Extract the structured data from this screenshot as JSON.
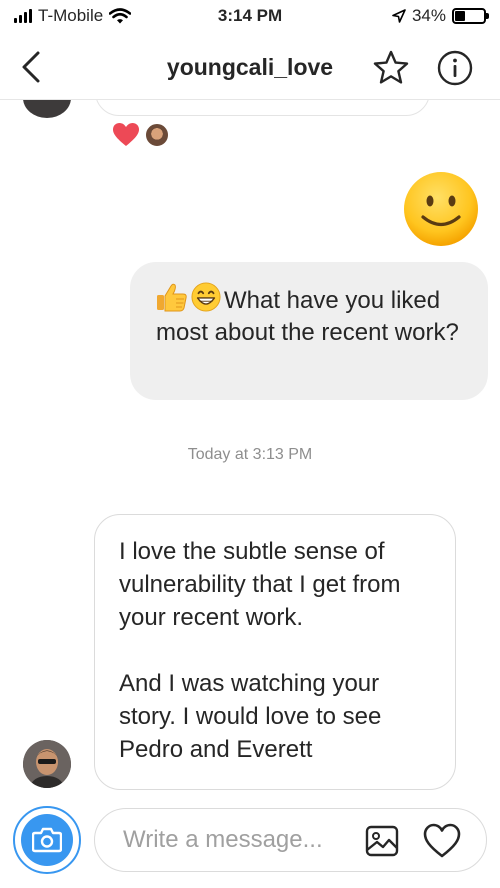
{
  "status_bar": {
    "carrier": "T-Mobile",
    "time": "3:14 PM",
    "battery_percent": "34%",
    "battery_level": 0.34
  },
  "header": {
    "username": "youngcali_love",
    "icons": [
      "chevron-left-icon",
      "star-icon",
      "info-icon"
    ]
  },
  "conversation": {
    "reactions": [
      "heart-reaction-icon"
    ],
    "sent_emoji": "smiling-face-emoji",
    "sent_message": {
      "emojis": [
        "thumbs-up-emoji",
        "grinning-face-emoji"
      ],
      "text": "What have you liked most about the recent work?"
    },
    "timestamp": "Today at 3:13 PM",
    "received_message": {
      "paragraph_1": "I love the subtle sense of vulnerability that I get from your recent work.",
      "paragraph_2": "And I was watching your story. I would love to see Pedro and Everett"
    }
  },
  "composer": {
    "placeholder": "Write a message...",
    "icons": [
      "camera-icon",
      "gallery-icon",
      "heart-icon"
    ]
  },
  "colors": {
    "accent": "#3897f0",
    "heart": "#ed4956",
    "bubble_grey": "#efefef",
    "timestamp": "#8e8e8e"
  }
}
